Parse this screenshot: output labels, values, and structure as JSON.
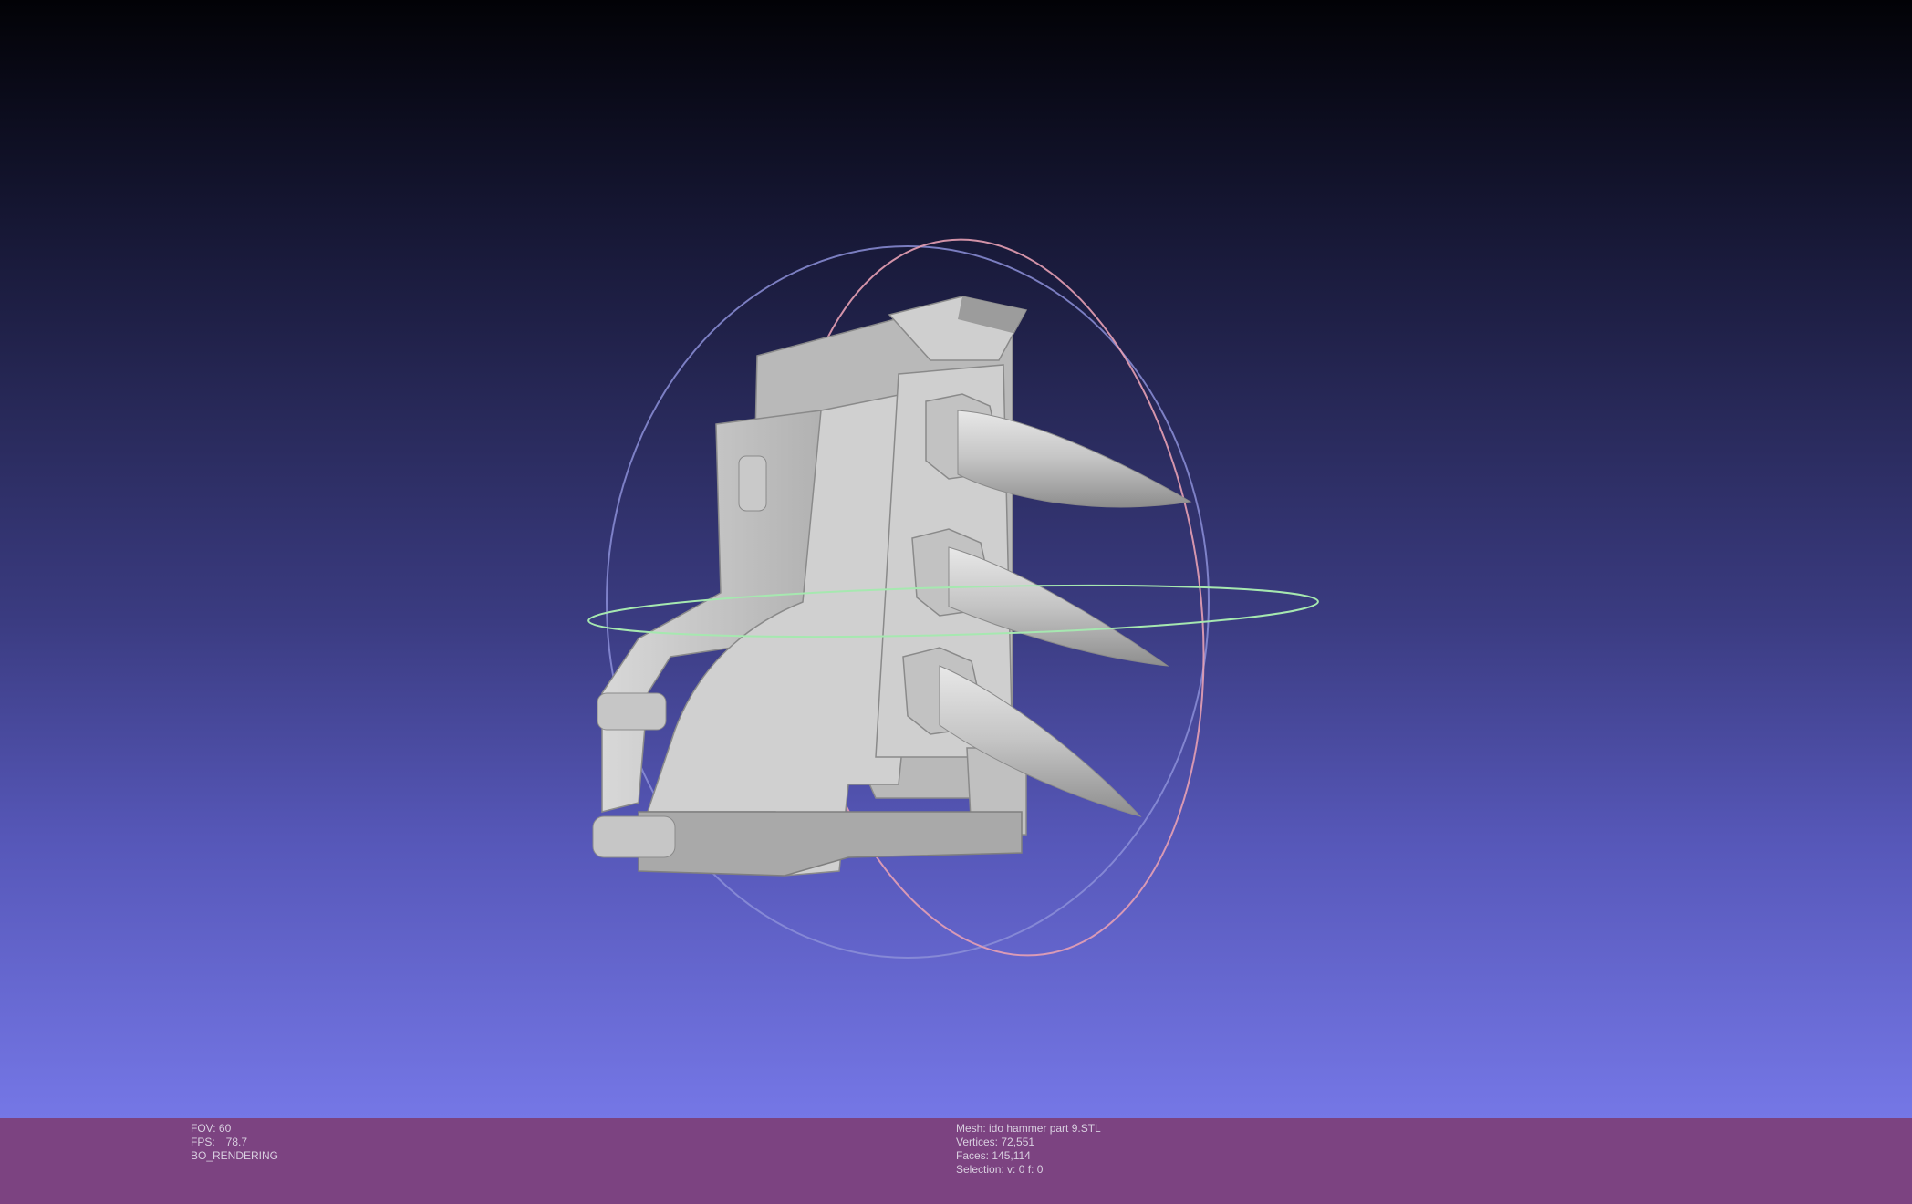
{
  "viewport": {
    "gradient_top": "#020206",
    "gradient_bottom": "#7577e6",
    "model": "hammer-head-with-spikes"
  },
  "status_left": {
    "fov": "FOV: 60",
    "fps_label": "FPS:",
    "fps_value": "78.7",
    "mode": "BO_RENDERING"
  },
  "status_right": {
    "mesh": "Mesh: ido hammer part 9.STL",
    "vertices": "Vertices: 72,551",
    "faces": "Faces: 145,114",
    "selection": "Selection: v: 0 f: 0"
  },
  "colors": {
    "status_bar": "#7c4381",
    "model_gray": "#c8c8c8",
    "trackball_red": "#e7a0b4",
    "trackball_green": "#a6e8b0",
    "trackball_blue": "#8c8fd8"
  }
}
